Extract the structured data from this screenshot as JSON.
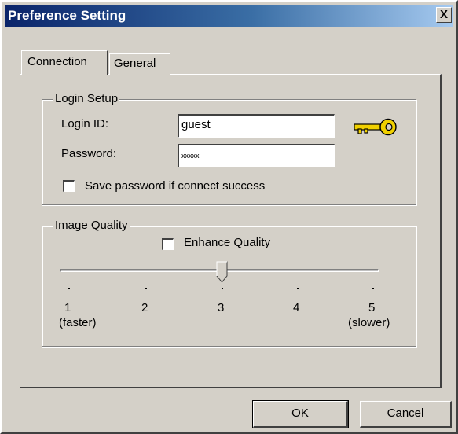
{
  "window": {
    "title": "Preference Setting",
    "close_glyph": "X"
  },
  "tabs": [
    {
      "label": "Connection",
      "active": true
    },
    {
      "label": "General",
      "active": false
    }
  ],
  "login_setup": {
    "legend": "Login Setup",
    "login_id_label": "Login ID:",
    "login_id_value": "guest",
    "password_label": "Password:",
    "password_value": "xxxxx",
    "save_password_label": "Save password if connect success",
    "save_password_checked": false,
    "key_icon": "key-icon"
  },
  "image_quality": {
    "legend": "Image Quality",
    "enhance_label": "Enhance Quality",
    "enhance_checked": false,
    "slider": {
      "min": 1,
      "max": 5,
      "value": 3,
      "ticks": [
        "1",
        "2",
        "3",
        "4",
        "5"
      ],
      "min_caption": "(faster)",
      "max_caption": "(slower)"
    }
  },
  "buttons": {
    "ok": "OK",
    "cancel": "Cancel"
  },
  "colors": {
    "face": "#d4d0c8",
    "title_start": "#0a246a",
    "title_end": "#a6caf0",
    "key": "#f0d000"
  }
}
